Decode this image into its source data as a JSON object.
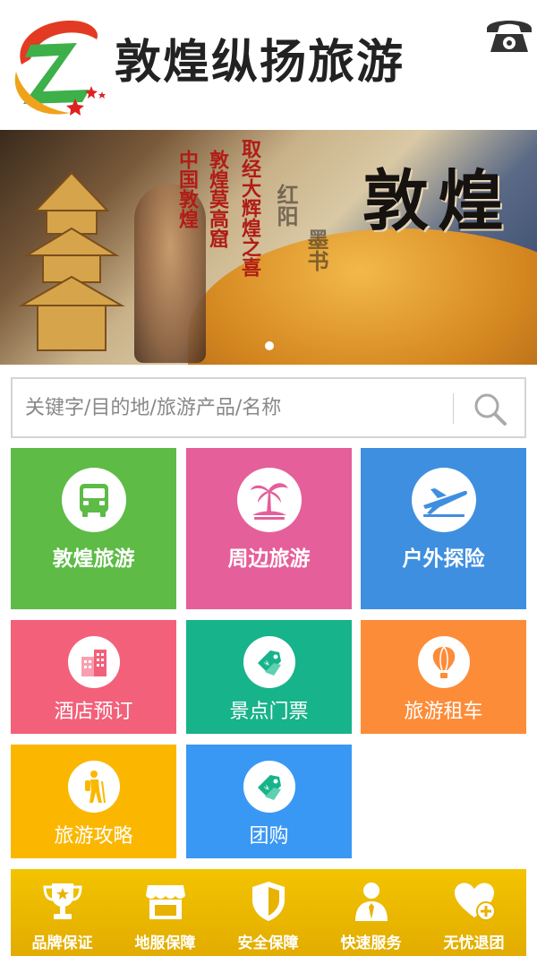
{
  "header": {
    "brand": "敦煌纵扬旅游",
    "logo_icon": "z-swoosh-logo",
    "phone_icon": "telephone-icon"
  },
  "banner": {
    "title": "敦煌",
    "calligraphy_red": [
      "中国敦煌",
      "敦煌莫高窟",
      "取经大辉煌之喜"
    ],
    "calligraphy_dark": [
      "红阳",
      "墨书"
    ],
    "slides": 1
  },
  "search": {
    "placeholder": "关键字/目的地/旅游产品/名称",
    "icon": "search-icon"
  },
  "tiles": [
    {
      "label": "敦煌旅游",
      "icon": "bus-icon",
      "color": "#5dbb46"
    },
    {
      "label": "周边旅游",
      "icon": "palm-tree-icon",
      "color": "#e55f9a"
    },
    {
      "label": "户外探险",
      "icon": "airplane-icon",
      "color": "#3f8fe0"
    },
    {
      "label": "酒店预订",
      "icon": "hotel-icon",
      "color": "#f3607a"
    },
    {
      "label": "景点门票",
      "icon": "ticket-tag-icon",
      "color": "#17b38a"
    },
    {
      "label": "旅游租车",
      "icon": "hot-air-balloon-icon",
      "color": "#fd8c39"
    },
    {
      "label": "旅游攻略",
      "icon": "hiker-icon",
      "color": "#fbb700"
    },
    {
      "label": "团购",
      "icon": "ticket-tag-icon",
      "color": "#3a98f5"
    }
  ],
  "guarantees": [
    {
      "label": "品牌保证",
      "icon": "trophy-icon"
    },
    {
      "label": "地服保障",
      "icon": "storefront-icon"
    },
    {
      "label": "安全保障",
      "icon": "shield-icon"
    },
    {
      "label": "快速服务",
      "icon": "agent-icon"
    },
    {
      "label": "无忧退团",
      "icon": "heart-plus-icon"
    }
  ],
  "colors": {
    "guarantee_bar": "#f3c400",
    "brand_red": "#e02020",
    "brand_green": "#3bb34a"
  }
}
